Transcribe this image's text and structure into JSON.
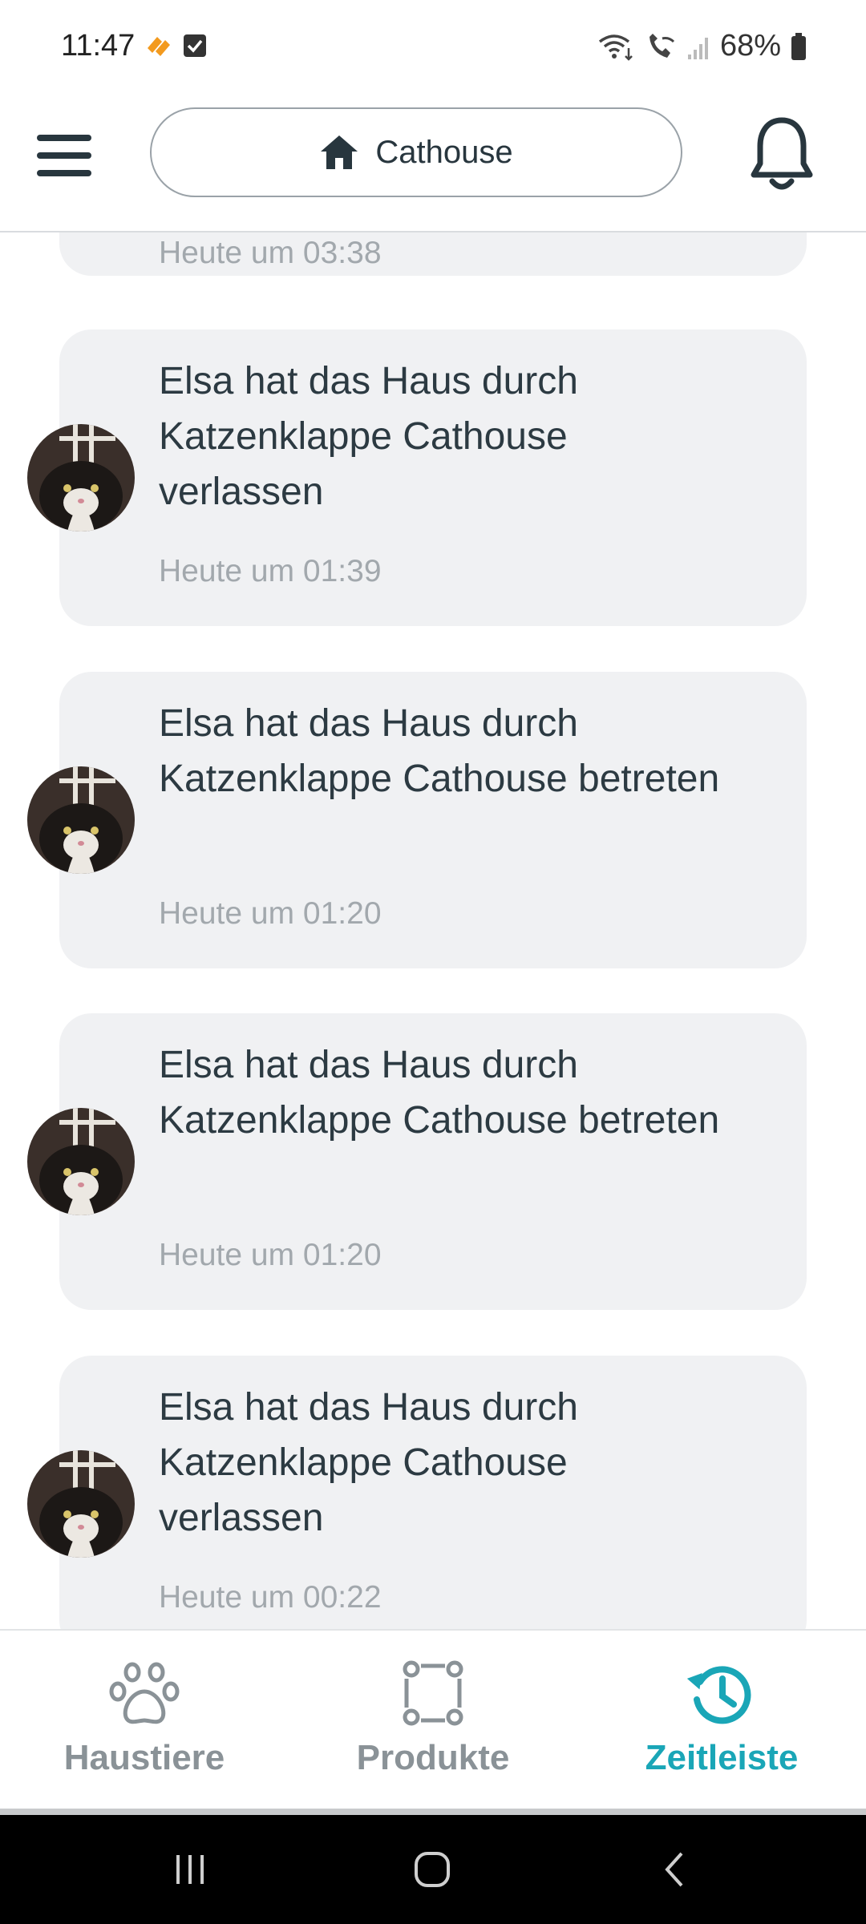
{
  "status_bar": {
    "time": "11:47",
    "battery": "68%"
  },
  "header": {
    "location": "Cathouse",
    "icons": [
      "menu-icon",
      "home-icon",
      "bell-icon"
    ]
  },
  "timeline": {
    "partial_top_time": "Heute um 03:38",
    "events": [
      {
        "text": "Elsa hat das Haus durch Katzenklappe Cathouse verlassen",
        "time": "Heute um 01:39"
      },
      {
        "text": "Elsa hat das Haus durch Katzenklappe Cathouse betreten",
        "time": "Heute um 01:20"
      },
      {
        "text": "Elsa hat das Haus durch Katzenklappe Cathouse betreten",
        "time": "Heute um 01:20"
      },
      {
        "text": "Elsa hat das Haus durch Katzenklappe Cathouse verlassen",
        "time": "Heute um 00:22"
      }
    ]
  },
  "bottom_nav": {
    "items": [
      {
        "label": "Haustiere",
        "icon": "paw-icon"
      },
      {
        "label": "Produkte",
        "icon": "products-icon"
      },
      {
        "label": "Zeitleiste",
        "icon": "history-icon"
      }
    ],
    "active": "Zeitleiste"
  },
  "colors": {
    "accent": "#1aa6b7",
    "card_background": "#f0f1f3",
    "text_primary": "#2c3a42",
    "text_secondary": "#a2a8ad",
    "nav_inactive": "#8a9297"
  }
}
